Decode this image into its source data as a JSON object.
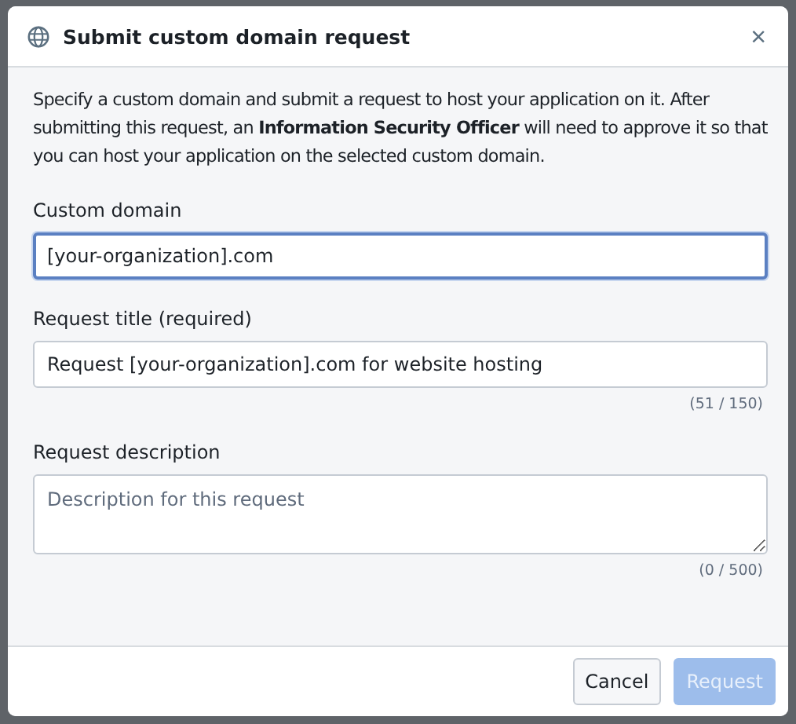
{
  "dialog": {
    "title": "Submit custom domain request",
    "close": "×",
    "intro": "Specify a custom domain and submit a request to host your application on it. After submitting this request, an **Information Security Officer** will need to approve it so that you can host your application on the selected custom domain.",
    "fields": [
      {
        "kind": "input",
        "label": "Custom domain",
        "value": "[your-organization].com",
        "focused": true
      },
      {
        "kind": "input",
        "label": "Request title (required)",
        "value": "Request [your-organization].com for website hosting",
        "focused": false,
        "counter": "(51 / 150)"
      },
      {
        "kind": "textarea",
        "label": "Request description",
        "placeholder": "Description for this request",
        "focused": false,
        "counter": "(0 / 500)"
      }
    ],
    "buttons": [
      {
        "label": "Cancel",
        "kind": "secondary",
        "disabled": false
      },
      {
        "label": "Request",
        "kind": "primary",
        "disabled": true
      }
    ]
  }
}
